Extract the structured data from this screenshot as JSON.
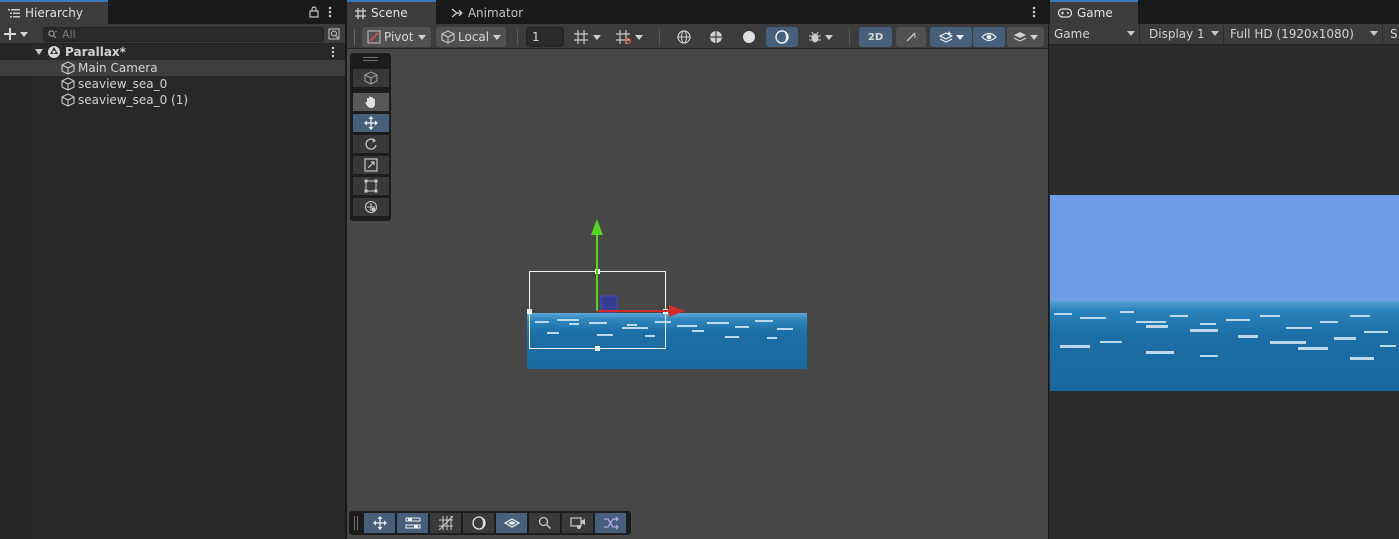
{
  "hierarchy": {
    "tab_label": "Hierarchy",
    "search_placeholder": "All",
    "scene_name": "Parallax*",
    "items": [
      {
        "label": "Main Camera",
        "selected": true
      },
      {
        "label": "seaview_sea_0",
        "selected": false
      },
      {
        "label": "seaview_sea_0 (1)",
        "selected": false
      }
    ]
  },
  "scene": {
    "tabs": [
      {
        "label": "Scene",
        "icon": "grid-icon",
        "active": true
      },
      {
        "label": "Animator",
        "icon": "animator-icon",
        "active": false
      }
    ],
    "toolbar": {
      "pivot_label": "Pivot",
      "local_label": "Local",
      "grid_snap_value": "1",
      "mode_2d_label": "2D"
    }
  },
  "game": {
    "tab_label": "Game",
    "view_label": "Game",
    "display_label": "Display 1",
    "resolution_label": "Full HD (1920x1080)",
    "scale_label": "S"
  },
  "colors": {
    "accent_blue": "#46607c",
    "selection_blue": "#3a79bb",
    "sky": "#6e9ce6",
    "sea": "#1b6aa0",
    "gizmo_y": "#56d424",
    "gizmo_x": "#d42a2a"
  }
}
